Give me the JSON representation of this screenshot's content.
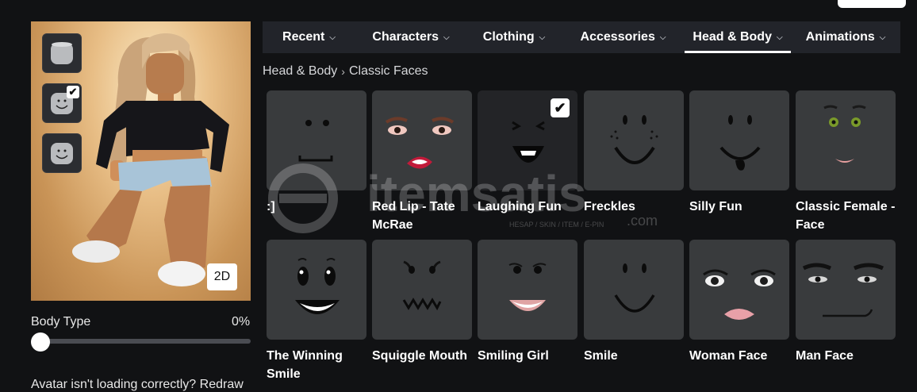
{
  "tabs": [
    {
      "label": "Recent",
      "active": false
    },
    {
      "label": "Characters",
      "active": false
    },
    {
      "label": "Clothing",
      "active": false
    },
    {
      "label": "Accessories",
      "active": false
    },
    {
      "label": "Head & Body",
      "active": true
    },
    {
      "label": "Animations",
      "active": false
    }
  ],
  "breadcrumb": {
    "parent": "Head & Body",
    "current": "Classic Faces"
  },
  "avatar": {
    "view_toggle_label": "2D",
    "head_buttons": [
      {
        "icon": "blank-head-icon",
        "selected": false
      },
      {
        "icon": "smiling-head-icon",
        "selected": true
      },
      {
        "icon": "smiling-head-icon",
        "selected": false
      }
    ]
  },
  "body_type": {
    "label": "Body Type",
    "value": "0%",
    "fraction": 0.0
  },
  "redraw": {
    "text": "Avatar isn't loading correctly?",
    "link": "Redraw"
  },
  "items": [
    {
      "name": ":]",
      "selected": false
    },
    {
      "name": "Red Lip - Tate McRae",
      "selected": false
    },
    {
      "name": "Laughing Fun",
      "selected": true
    },
    {
      "name": "Freckles",
      "selected": false
    },
    {
      "name": "Silly Fun",
      "selected": false
    },
    {
      "name": "Classic Female - Face",
      "selected": false
    },
    {
      "name": "The Winning Smile",
      "selected": false
    },
    {
      "name": "Squiggle Mouth",
      "selected": false
    },
    {
      "name": "Smiling Girl",
      "selected": false
    },
    {
      "name": "Smile",
      "selected": false
    },
    {
      "name": "Woman Face",
      "selected": false
    },
    {
      "name": "Man Face",
      "selected": false
    }
  ],
  "watermark": {
    "brand": "itemsatis",
    "suffix": ".com",
    "tagline": "HESAP / SKIN / ITEM / E-PIN"
  },
  "colors": {
    "background": "#111214",
    "tab_bar": "#22242a",
    "tile": "#393b3d",
    "tile_selected": "#232427",
    "accent": "#ffffff"
  }
}
